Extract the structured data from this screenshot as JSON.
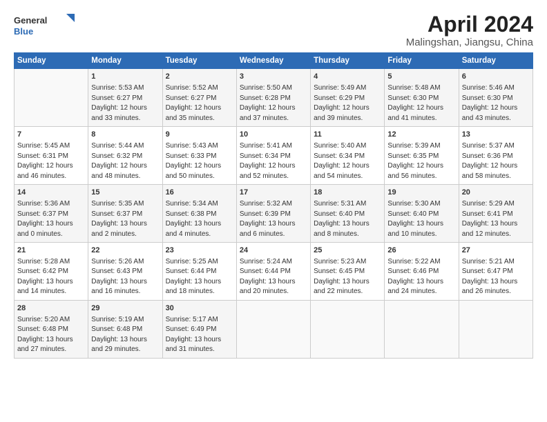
{
  "logo": {
    "line1": "General",
    "line2": "Blue"
  },
  "title": "April 2024",
  "subtitle": "Malingshan, Jiangsu, China",
  "days_header": [
    "Sunday",
    "Monday",
    "Tuesday",
    "Wednesday",
    "Thursday",
    "Friday",
    "Saturday"
  ],
  "weeks": [
    {
      "cells": [
        {
          "day": "",
          "data": ""
        },
        {
          "day": "1",
          "data": "Sunrise: 5:53 AM\nSunset: 6:27 PM\nDaylight: 12 hours\nand 33 minutes."
        },
        {
          "day": "2",
          "data": "Sunrise: 5:52 AM\nSunset: 6:27 PM\nDaylight: 12 hours\nand 35 minutes."
        },
        {
          "day": "3",
          "data": "Sunrise: 5:50 AM\nSunset: 6:28 PM\nDaylight: 12 hours\nand 37 minutes."
        },
        {
          "day": "4",
          "data": "Sunrise: 5:49 AM\nSunset: 6:29 PM\nDaylight: 12 hours\nand 39 minutes."
        },
        {
          "day": "5",
          "data": "Sunrise: 5:48 AM\nSunset: 6:30 PM\nDaylight: 12 hours\nand 41 minutes."
        },
        {
          "day": "6",
          "data": "Sunrise: 5:46 AM\nSunset: 6:30 PM\nDaylight: 12 hours\nand 43 minutes."
        }
      ]
    },
    {
      "cells": [
        {
          "day": "7",
          "data": "Sunrise: 5:45 AM\nSunset: 6:31 PM\nDaylight: 12 hours\nand 46 minutes."
        },
        {
          "day": "8",
          "data": "Sunrise: 5:44 AM\nSunset: 6:32 PM\nDaylight: 12 hours\nand 48 minutes."
        },
        {
          "day": "9",
          "data": "Sunrise: 5:43 AM\nSunset: 6:33 PM\nDaylight: 12 hours\nand 50 minutes."
        },
        {
          "day": "10",
          "data": "Sunrise: 5:41 AM\nSunset: 6:34 PM\nDaylight: 12 hours\nand 52 minutes."
        },
        {
          "day": "11",
          "data": "Sunrise: 5:40 AM\nSunset: 6:34 PM\nDaylight: 12 hours\nand 54 minutes."
        },
        {
          "day": "12",
          "data": "Sunrise: 5:39 AM\nSunset: 6:35 PM\nDaylight: 12 hours\nand 56 minutes."
        },
        {
          "day": "13",
          "data": "Sunrise: 5:37 AM\nSunset: 6:36 PM\nDaylight: 12 hours\nand 58 minutes."
        }
      ]
    },
    {
      "cells": [
        {
          "day": "14",
          "data": "Sunrise: 5:36 AM\nSunset: 6:37 PM\nDaylight: 13 hours\nand 0 minutes."
        },
        {
          "day": "15",
          "data": "Sunrise: 5:35 AM\nSunset: 6:37 PM\nDaylight: 13 hours\nand 2 minutes."
        },
        {
          "day": "16",
          "data": "Sunrise: 5:34 AM\nSunset: 6:38 PM\nDaylight: 13 hours\nand 4 minutes."
        },
        {
          "day": "17",
          "data": "Sunrise: 5:32 AM\nSunset: 6:39 PM\nDaylight: 13 hours\nand 6 minutes."
        },
        {
          "day": "18",
          "data": "Sunrise: 5:31 AM\nSunset: 6:40 PM\nDaylight: 13 hours\nand 8 minutes."
        },
        {
          "day": "19",
          "data": "Sunrise: 5:30 AM\nSunset: 6:40 PM\nDaylight: 13 hours\nand 10 minutes."
        },
        {
          "day": "20",
          "data": "Sunrise: 5:29 AM\nSunset: 6:41 PM\nDaylight: 13 hours\nand 12 minutes."
        }
      ]
    },
    {
      "cells": [
        {
          "day": "21",
          "data": "Sunrise: 5:28 AM\nSunset: 6:42 PM\nDaylight: 13 hours\nand 14 minutes."
        },
        {
          "day": "22",
          "data": "Sunrise: 5:26 AM\nSunset: 6:43 PM\nDaylight: 13 hours\nand 16 minutes."
        },
        {
          "day": "23",
          "data": "Sunrise: 5:25 AM\nSunset: 6:44 PM\nDaylight: 13 hours\nand 18 minutes."
        },
        {
          "day": "24",
          "data": "Sunrise: 5:24 AM\nSunset: 6:44 PM\nDaylight: 13 hours\nand 20 minutes."
        },
        {
          "day": "25",
          "data": "Sunrise: 5:23 AM\nSunset: 6:45 PM\nDaylight: 13 hours\nand 22 minutes."
        },
        {
          "day": "26",
          "data": "Sunrise: 5:22 AM\nSunset: 6:46 PM\nDaylight: 13 hours\nand 24 minutes."
        },
        {
          "day": "27",
          "data": "Sunrise: 5:21 AM\nSunset: 6:47 PM\nDaylight: 13 hours\nand 26 minutes."
        }
      ]
    },
    {
      "cells": [
        {
          "day": "28",
          "data": "Sunrise: 5:20 AM\nSunset: 6:48 PM\nDaylight: 13 hours\nand 27 minutes."
        },
        {
          "day": "29",
          "data": "Sunrise: 5:19 AM\nSunset: 6:48 PM\nDaylight: 13 hours\nand 29 minutes."
        },
        {
          "day": "30",
          "data": "Sunrise: 5:17 AM\nSunset: 6:49 PM\nDaylight: 13 hours\nand 31 minutes."
        },
        {
          "day": "",
          "data": ""
        },
        {
          "day": "",
          "data": ""
        },
        {
          "day": "",
          "data": ""
        },
        {
          "day": "",
          "data": ""
        }
      ]
    }
  ]
}
